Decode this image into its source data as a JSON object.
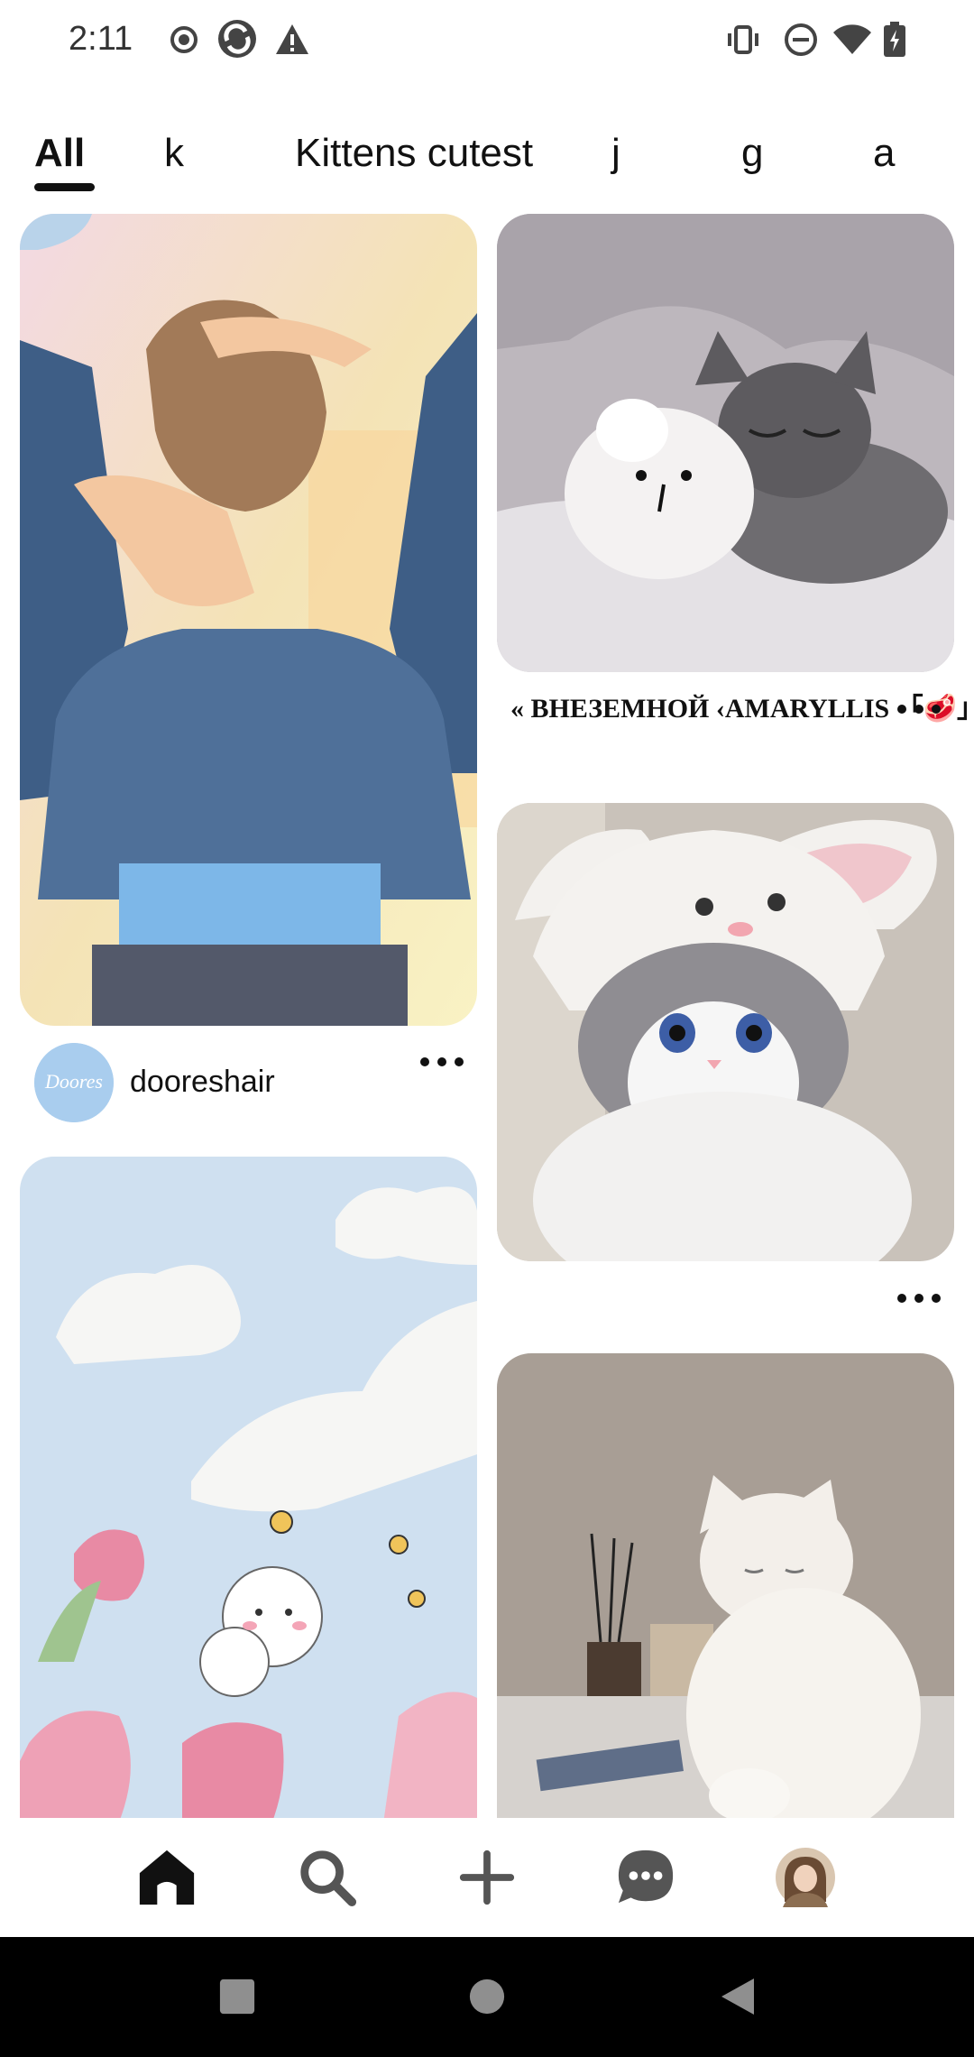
{
  "status_bar": {
    "time": "2:11",
    "left_icons": [
      "record-icon",
      "sync-app-icon",
      "warning-icon"
    ],
    "right_icons": [
      "vibrate-icon",
      "do-not-disturb-icon",
      "wifi-icon",
      "battery-charging-icon"
    ]
  },
  "tabs": [
    {
      "label": "All",
      "active": true
    },
    {
      "label": "k",
      "active": false
    },
    {
      "label": "Kittens cutest",
      "active": false
    },
    {
      "label": "j",
      "active": false
    },
    {
      "label": "g",
      "active": false
    },
    {
      "label": "a",
      "active": false
    }
  ],
  "feed": {
    "left_column": [
      {
        "image": "girl-tying-hair-illustration",
        "author_avatar_text": "Doores",
        "author_name": "dooreshair"
      },
      {
        "image": "pastel-cat-tulips-illustration"
      }
    ],
    "right_column": [
      {
        "image": "kitten-sleeping-with-plush",
        "caption": "« ВНЕЗЕМНОЙ ‹AMARYLLIS 「🥩」ˇ"
      },
      {
        "image": "cat-in-bunny-hat"
      },
      {
        "image": "white-fluffy-cat"
      }
    ]
  },
  "bottom_nav": [
    {
      "icon": "home-icon",
      "active": true
    },
    {
      "icon": "search-icon",
      "active": false
    },
    {
      "icon": "plus-icon",
      "active": false
    },
    {
      "icon": "messages-icon",
      "active": false
    },
    {
      "icon": "profile-avatar",
      "active": false
    }
  ],
  "system_nav": [
    "recents-icon",
    "home-circle-icon",
    "back-icon"
  ],
  "colors": {
    "accent": "#111111",
    "background": "#ffffff",
    "nav_bar": "#000000"
  }
}
